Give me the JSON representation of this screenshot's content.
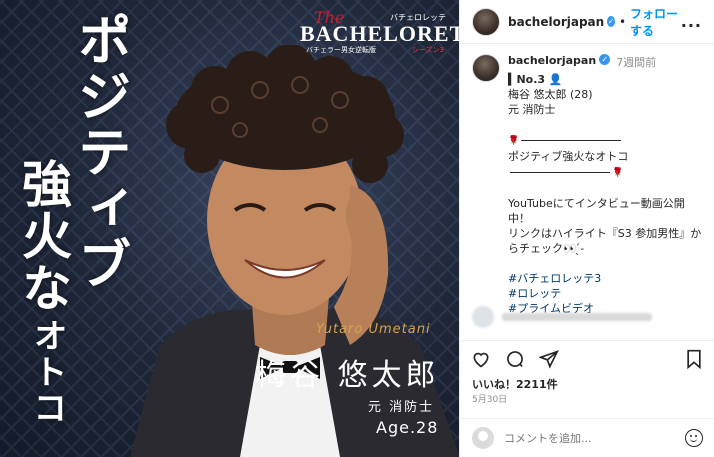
{
  "post_image": {
    "vertical_title_1": "ポジティブ",
    "vertical_title_2": "強火な",
    "vertical_title_3": "オトコ",
    "logo": {
      "the": "The",
      "main": "BACHELORETTE",
      "small_top": "バチェロレッテ",
      "sub_left": "バチェラー男女逆転版",
      "sub_right": "シーズン3"
    },
    "name_en": "Yutaro Umetani",
    "name_jp": "梅谷 悠太郎",
    "occupation": "元 消防士",
    "age": "Age.28"
  },
  "header": {
    "username": "bachelorjapan",
    "verified_mark": "✓",
    "separator": "•",
    "follow_label": "フォローする",
    "more_label": "..."
  },
  "caption": {
    "username": "bachelorjapan",
    "time": "7週間前",
    "lines": {
      "number": "No.3",
      "name": "梅谷 悠太郎 (28)",
      "occupation": "元 消防士",
      "tagline": "ポジティブ強火なオトコ",
      "promo1": "YouTubeにてインタビュー動画公開",
      "promo2": "中！",
      "promo3": "リンクはハイライト『S3 参加男性』か",
      "promo4": "らチェック👀 ̖́-",
      "tag1": "#バチェロレッテ3",
      "tag2": "#ロレッテ",
      "tag3": "#プライムビデオ"
    }
  },
  "likes": "いいね！2211件",
  "date": "5月30日",
  "comment": {
    "placeholder": "コメントを追加..."
  },
  "colors": {
    "link_blue": "#0095f6",
    "verified_blue": "#3897f0",
    "hashtag": "#00376b",
    "name_gold": "#d8a24a"
  },
  "icons": [
    "heart-icon",
    "comment-icon",
    "share-icon",
    "bookmark-icon",
    "emoji-icon",
    "verified-icon"
  ]
}
